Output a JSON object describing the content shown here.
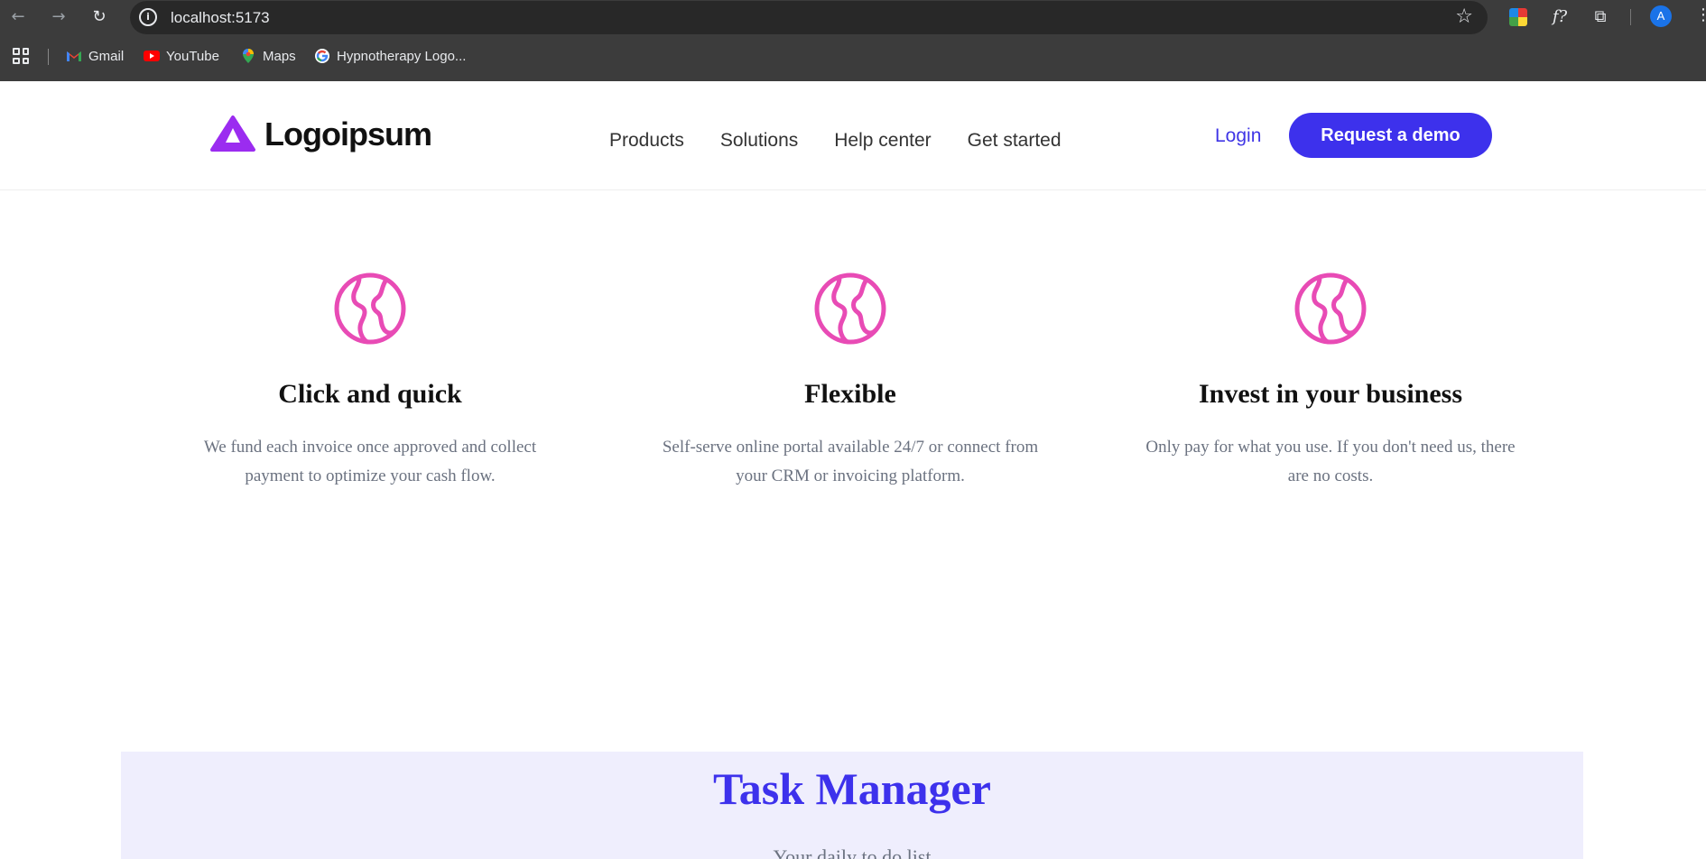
{
  "browser": {
    "url": "localhost:5173",
    "avatar_letter": "A",
    "bookmarks": [
      {
        "label": "Gmail",
        "icon": "gmail-icon"
      },
      {
        "label": "YouTube",
        "icon": "youtube-icon"
      },
      {
        "label": "Maps",
        "icon": "maps-icon"
      },
      {
        "label": "Hypnotherapy Logo...",
        "icon": "google-icon"
      }
    ]
  },
  "header": {
    "logo_text": "Logoipsum",
    "nav": [
      "Products",
      "Solutions",
      "Help center",
      "Get started"
    ],
    "login_label": "Login",
    "demo_label": "Request a demo"
  },
  "features": [
    {
      "title": "Click and quick",
      "text": "We fund each invoice once approved and collect payment to optimize your cash flow.",
      "icon": "globe-icon"
    },
    {
      "title": "Flexible",
      "text": "Self-serve online portal available 24/7 or connect from your CRM or invoicing platform.",
      "icon": "globe-icon"
    },
    {
      "title": "Invest in your business",
      "text": "Only pay for what you use. If you don't need us, there are no costs.",
      "icon": "globe-icon"
    }
  ],
  "task_manager": {
    "title": "Task Manager",
    "subtitle": "Your daily to do list"
  },
  "colors": {
    "brand": "#3d31ec",
    "icon_pink": "#e84bb5",
    "logo_purple": "#9b2cf0"
  }
}
